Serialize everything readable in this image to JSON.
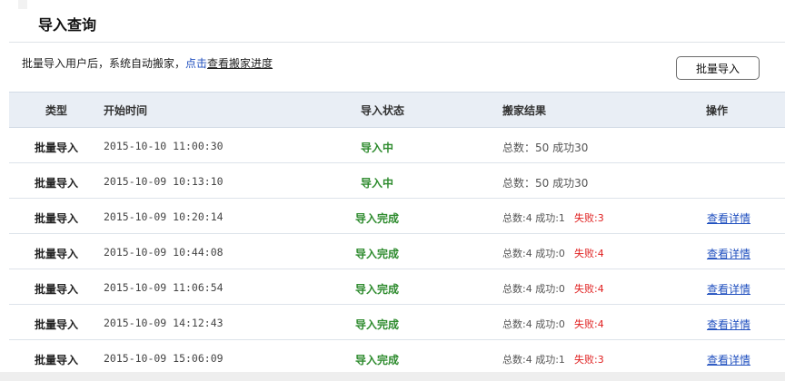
{
  "page": {
    "title": "导入查询"
  },
  "tip": {
    "text": "批量导入用户后，系统自动搬家，",
    "link_prefix": "点击",
    "link_text": "查看搬家进度"
  },
  "toolbar": {
    "import_label": "批量导入"
  },
  "table": {
    "headers": [
      "类型",
      "开始时间",
      "导入状态",
      "搬家结果",
      "操作"
    ],
    "rows": [
      {
        "type": "批量导入",
        "time": "2015-10-10 11:00:30",
        "status": "导入中",
        "result": "总数：50 成功30",
        "fail": "",
        "action": ""
      },
      {
        "type": "批量导入",
        "time": "2015-10-09 10:13:10",
        "status": "导入中",
        "result": "总数：50 成功30",
        "fail": "",
        "action": ""
      },
      {
        "type": "批量导入",
        "time": "2015-10-09 10:20:14",
        "status": "导入完成",
        "result": "总数:4  成功:1",
        "fail": "失败:3",
        "action": "查看详情"
      },
      {
        "type": "批量导入",
        "time": "2015-10-09 10:44:08",
        "status": "导入完成",
        "result": "总数:4  成功:0",
        "fail": "失败:4",
        "action": "查看详情"
      },
      {
        "type": "批量导入",
        "time": "2015-10-09 11:06:54",
        "status": "导入完成",
        "result": "总数:4  成功:0",
        "fail": "失败:4",
        "action": "查看详情"
      },
      {
        "type": "批量导入",
        "time": "2015-10-09 14:12:43",
        "status": "导入完成",
        "result": "总数:4  成功:0",
        "fail": "失败:4",
        "action": "查看详情"
      },
      {
        "type": "批量导入",
        "time": "2015-10-09 15:06:09",
        "status": "导入完成",
        "result": "总数:4  成功:1",
        "fail": "失败:3",
        "action": "查看详情"
      }
    ]
  }
}
